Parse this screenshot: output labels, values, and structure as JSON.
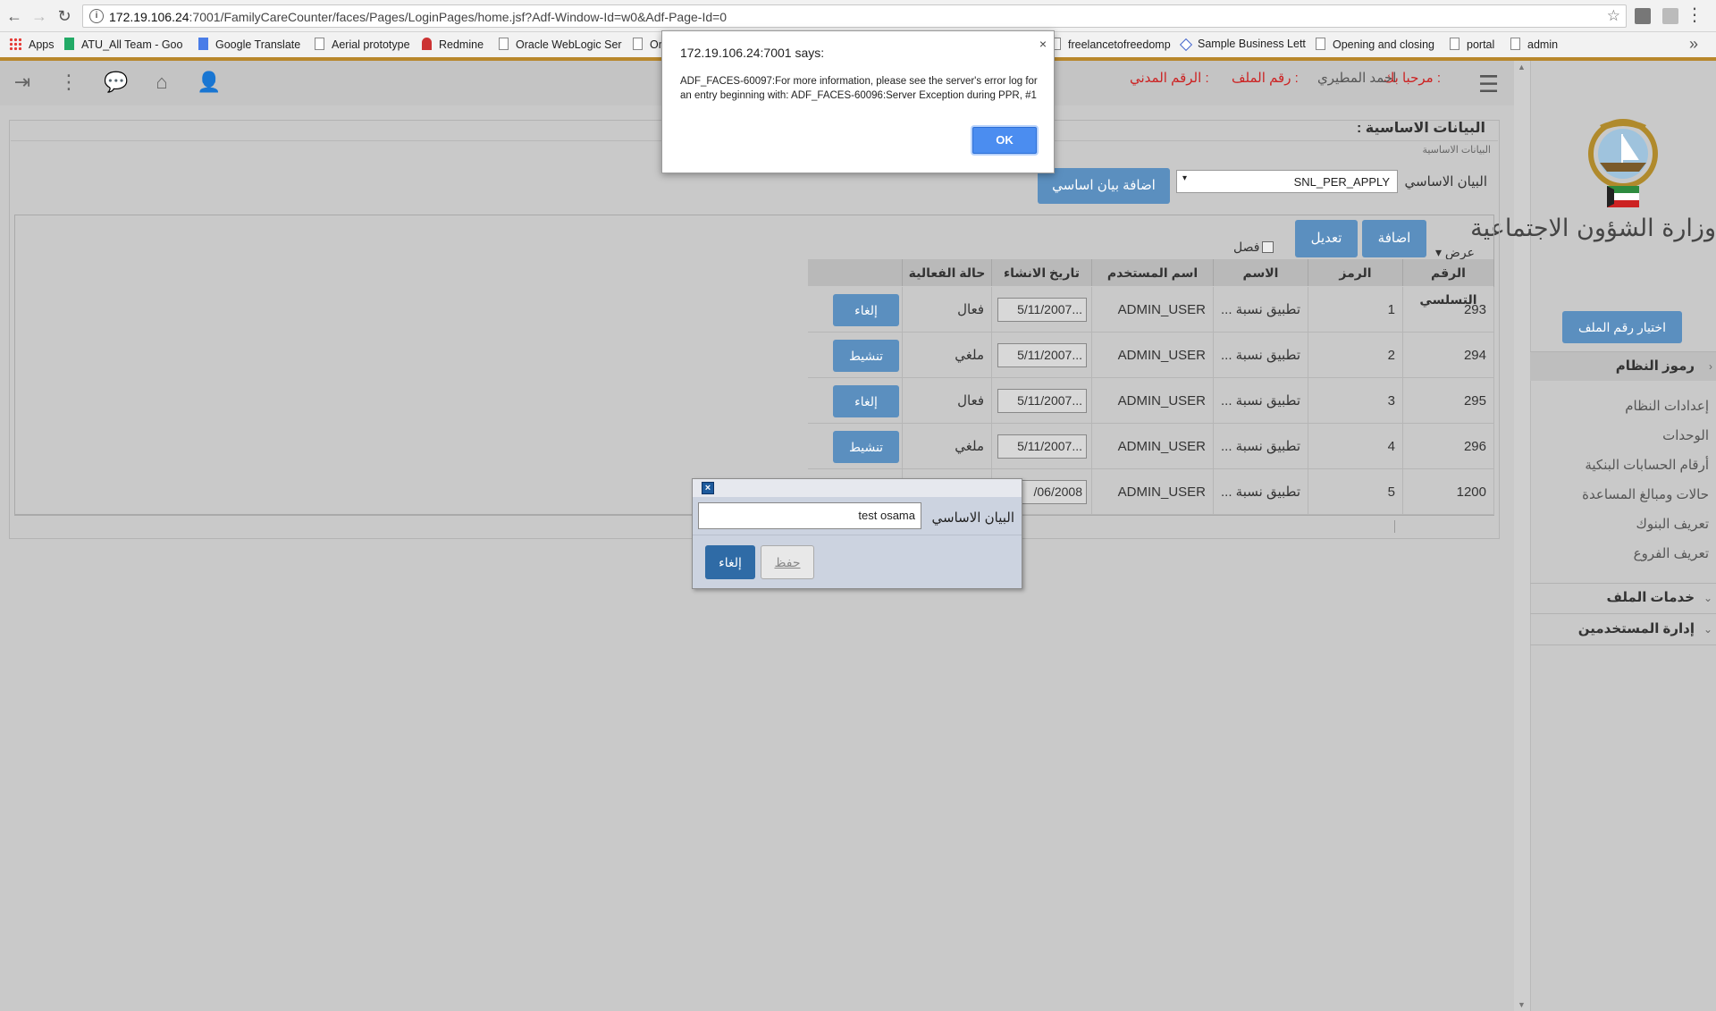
{
  "browser": {
    "url_host": "172.19.106.24",
    "url_rest": ":7001/FamilyCareCounter/faces/Pages/LoginPages/home.jsf?Adf-Window-Id=w0&Adf-Page-Id=0",
    "bookmarks": [
      "Apps",
      "ATU_All Team - Goo",
      "Google Translate",
      "Aerial prototype",
      "Redmine",
      "Oracle WebLogic Ser",
      "Or",
      "freelancetofreedomp",
      "Sample Business Lett",
      "Opening and closing",
      "portal",
      "admin"
    ],
    "more": "»"
  },
  "header": {
    "welcome_label": "مرحبا بك :",
    "user_name": "احمد المطيري",
    "file_label": "رقم الملف :",
    "civil_label": "الرقم المدني :"
  },
  "sidebar": {
    "ministry": "وزارة الشؤون الاجتماعية",
    "file_button": "اختيار رقم الملف",
    "section_system": "رموز النظام",
    "items": [
      "إعدادات النظام",
      "الوحدات",
      "أرقام الحسابات البنكية",
      "حالات ومبالغ المساعدة",
      "تعريف البنوك",
      "تعريف الفروع"
    ],
    "section_files": "خدمات الملف",
    "section_users": "إدارة المستخدمين"
  },
  "main": {
    "title": "البيانات الاساسية :",
    "crumb": "البيانات الاساسية",
    "field_label": "البيان الاساسي",
    "select_value": "SNL_PER_APPLY",
    "select_arrow": "▾",
    "add_basic_button": "اضافة بيان اساسي",
    "view_menu": "عرض ▾",
    "detach": "فصل",
    "add_button": "اضافة",
    "edit_button": "تعديل"
  },
  "table": {
    "columns": [
      "الرقم التسلسي",
      "الرمز",
      "الاسم",
      "اسم المستخدم",
      "تاريخ الانشاء",
      "حالة الفعالية"
    ],
    "rows": [
      {
        "serial": "293",
        "code": "1",
        "name": "تطبيق نسبة ...",
        "user": "ADMIN_USER",
        "date": "5/11/2007...",
        "status": "فعال",
        "action": "إلغاء"
      },
      {
        "serial": "294",
        "code": "2",
        "name": "تطبيق نسبة ...",
        "user": "ADMIN_USER",
        "date": "5/11/2007...",
        "status": "ملغي",
        "action": "تنشيط"
      },
      {
        "serial": "295",
        "code": "3",
        "name": "تطبيق نسبة ...",
        "user": "ADMIN_USER",
        "date": "5/11/2007...",
        "status": "فعال",
        "action": "إلغاء"
      },
      {
        "serial": "296",
        "code": "4",
        "name": "تطبيق نسبة ...",
        "user": "ADMIN_USER",
        "date": "5/11/2007...",
        "status": "ملغي",
        "action": "تنشيط"
      },
      {
        "serial": "1200",
        "code": "5",
        "name": "تطبيق نسبة ...",
        "user": "ADMIN_USER",
        "date": "/06/2008",
        "status": "",
        "action": ""
      }
    ]
  },
  "popup": {
    "label": "البيان الاساسي",
    "value": "test osama",
    "save": "حفظ",
    "cancel": "إلغاء",
    "close": "×"
  },
  "alert": {
    "title": "172.19.106.24:7001 says:",
    "message": "ADF_FACES-60097:For more information, please see the server's error log for an entry beginning with: ADF_FACES-60096:Server Exception during PPR, #1",
    "ok": "OK",
    "close": "×"
  },
  "colors": {
    "accent": "#5b8fbf",
    "alert_ok": "#4b8df0",
    "header_red": "#cc2222"
  }
}
